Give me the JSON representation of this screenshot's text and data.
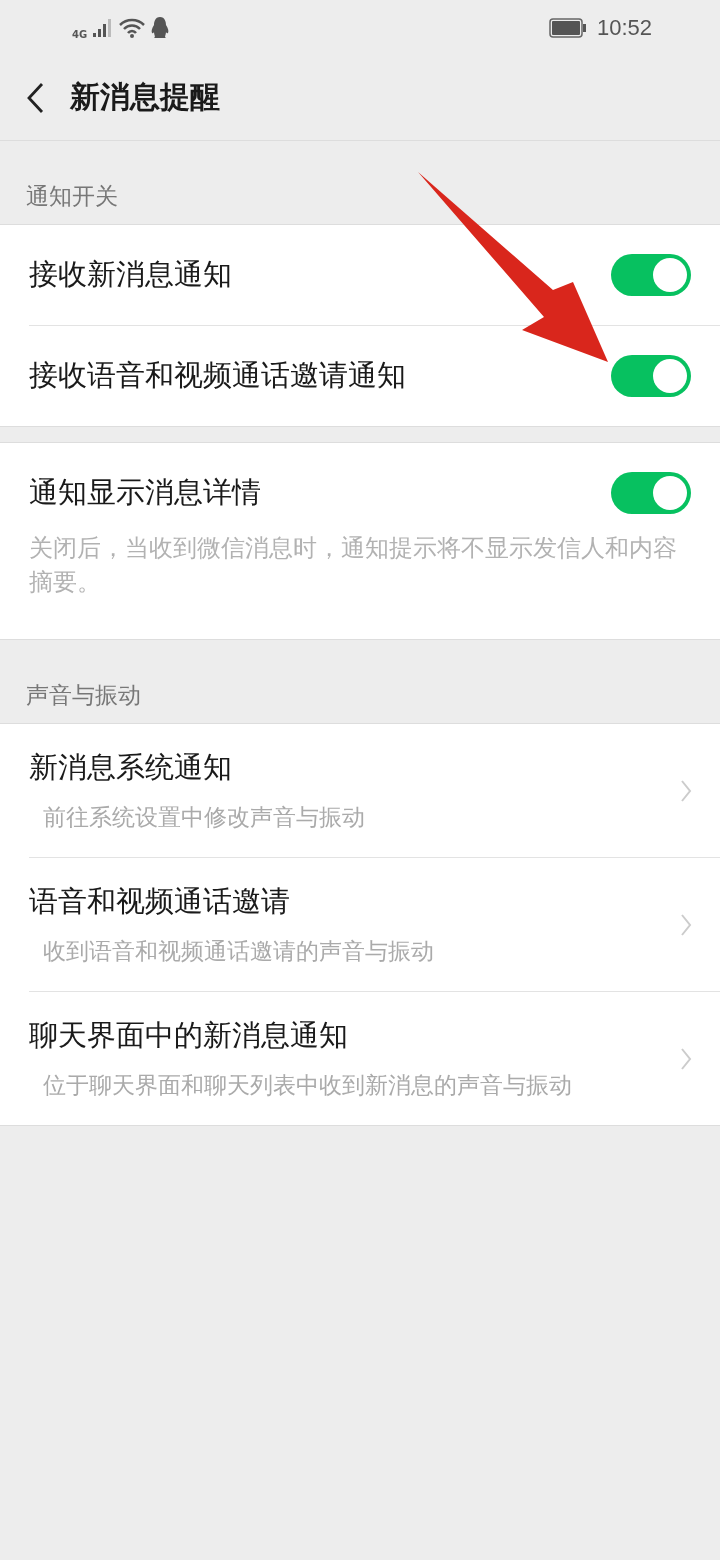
{
  "status_bar": {
    "network": "4G",
    "time": "10:52"
  },
  "header": {
    "title": "新消息提醒"
  },
  "sections": [
    {
      "label": "通知开关",
      "groups": [
        {
          "items": [
            {
              "kind": "toggle",
              "title": "接收新消息通知",
              "on": true
            },
            {
              "kind": "toggle",
              "title": "接收语音和视频通话邀请通知",
              "on": true
            }
          ]
        },
        {
          "items": [
            {
              "kind": "toggle",
              "title": "通知显示消息详情",
              "on": true,
              "description": "关闭后，当收到微信消息时，通知提示将不显示发信人和内容摘要。"
            }
          ]
        }
      ]
    },
    {
      "label": "声音与振动",
      "groups": [
        {
          "items": [
            {
              "kind": "link",
              "title": "新消息系统通知",
              "subtitle": "前往系统设置中修改声音与振动"
            },
            {
              "kind": "link",
              "title": "语音和视频通话邀请",
              "subtitle": "收到语音和视频通话邀请的声音与振动"
            },
            {
              "kind": "link",
              "title": "聊天界面中的新消息通知",
              "subtitle": "位于聊天界面和聊天列表中收到新消息的声音与振动"
            }
          ]
        }
      ]
    }
  ]
}
